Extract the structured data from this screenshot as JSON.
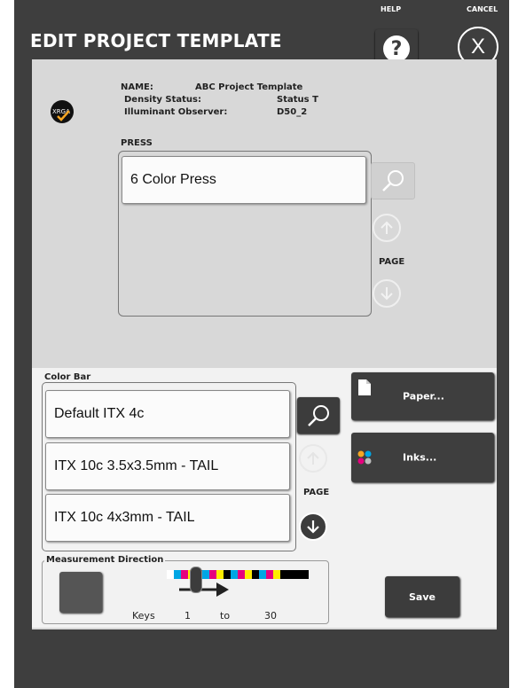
{
  "header": {
    "title": "EDIT PROJECT TEMPLATE",
    "help_label": "HELP",
    "help_icon_text": "?",
    "cancel_label": "CANCEL",
    "cancel_icon_text": "X"
  },
  "template_info": {
    "logo_text": "XRGA",
    "name_label": "NAME:",
    "name_value": "ABC Project Template",
    "density_label": "Density Status:",
    "density_value": "Status T",
    "illuminant_label": "Illuminant Observer:",
    "illuminant_value": "D50_2"
  },
  "press": {
    "label": "PRESS",
    "items": [
      "6 Color Press"
    ],
    "page_label": "PAGE"
  },
  "color_bar": {
    "label": "Color Bar",
    "items": [
      "Default ITX 4c",
      "ITX 10c 3.5x3.5mm - TAIL",
      "ITX 10c 4x3mm - TAIL"
    ],
    "page_label": "PAGE"
  },
  "side_buttons": {
    "paper_label": "Paper...",
    "inks_label": "Inks..."
  },
  "measurement": {
    "label": "Measurement Direction",
    "keys_label": "Keys",
    "keys_from": "1",
    "keys_to_label": "to",
    "keys_to": "30",
    "strip_colors": [
      "#ffffff",
      "#00a6e4",
      "#e6007e",
      "#ffec00",
      "#000000",
      "#00a6e4",
      "#e6007e",
      "#ffec00",
      "#000000",
      "#00a6e4",
      "#e6007e",
      "#ffec00",
      "#000000",
      "#00a6e4",
      "#e6007e",
      "#ffec00",
      "#000000",
      "#000000",
      "#000000",
      "#000000"
    ]
  },
  "footer": {
    "save_label": "Save"
  },
  "colors": {
    "dark_chrome": "#3e3e3e",
    "panel_gray": "#d8d8d8",
    "panel_light": "#f2f2f2",
    "accent_orange": "#f5a623"
  }
}
